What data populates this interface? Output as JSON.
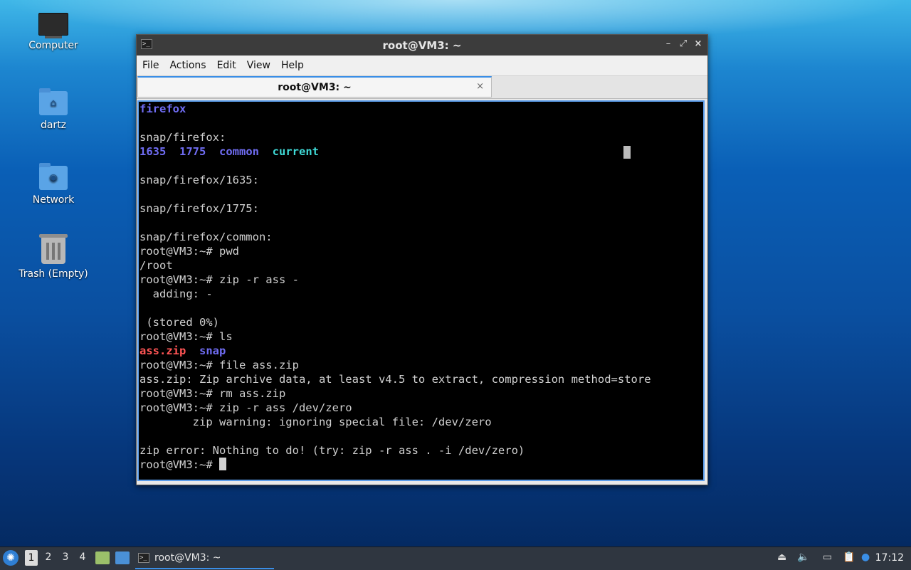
{
  "desktop": {
    "icons": [
      {
        "label": "Computer",
        "icon": "computer-icon"
      },
      {
        "label": "dartz",
        "icon": "home-folder-icon"
      },
      {
        "label": "Network",
        "icon": "network-folder-icon"
      },
      {
        "label": "Trash (Empty)",
        "icon": "trash-icon"
      }
    ]
  },
  "window": {
    "title": "root@VM3: ~",
    "controls": {
      "minimize": "–",
      "restore": "⤢",
      "close": "×"
    },
    "menu": [
      "File",
      "Actions",
      "Edit",
      "View",
      "Help"
    ],
    "tab": {
      "label": "root@VM3: ~",
      "close": "×"
    }
  },
  "terminal": {
    "lines": [
      "firefox",
      "",
      "snap/firefox:",
      "1635  1775  common  current",
      "",
      "snap/firefox/1635:",
      "",
      "snap/firefox/1775:",
      "",
      "snap/firefox/common:",
      "root@VM3:~# pwd",
      "/root",
      "root@VM3:~# zip -r ass -",
      "  adding: -",
      "",
      " (stored 0%)",
      "root@VM3:~# ls",
      "ass.zip  snap",
      "root@VM3:~# file ass.zip",
      "ass.zip: Zip archive data, at least v4.5 to extract, compression method=store",
      "root@VM3:~# rm ass.zip",
      "root@VM3:~# zip -r ass /dev/zero",
      "        zip warning: ignoring special file: /dev/zero",
      "",
      "zip error: Nothing to do! (try: zip -r ass . -i /dev/zero)",
      "root@VM3:~# "
    ],
    "colors": {
      "blue": "#6f6cf2",
      "cyan": "#3fd9d6",
      "red": "#ff5555",
      "text": "#d0d0d0"
    }
  },
  "taskbar": {
    "workspaces": [
      "1",
      "2",
      "3",
      "4"
    ],
    "active_workspace": "1",
    "task_label": "root@VM3: ~",
    "clock": "17:12"
  }
}
